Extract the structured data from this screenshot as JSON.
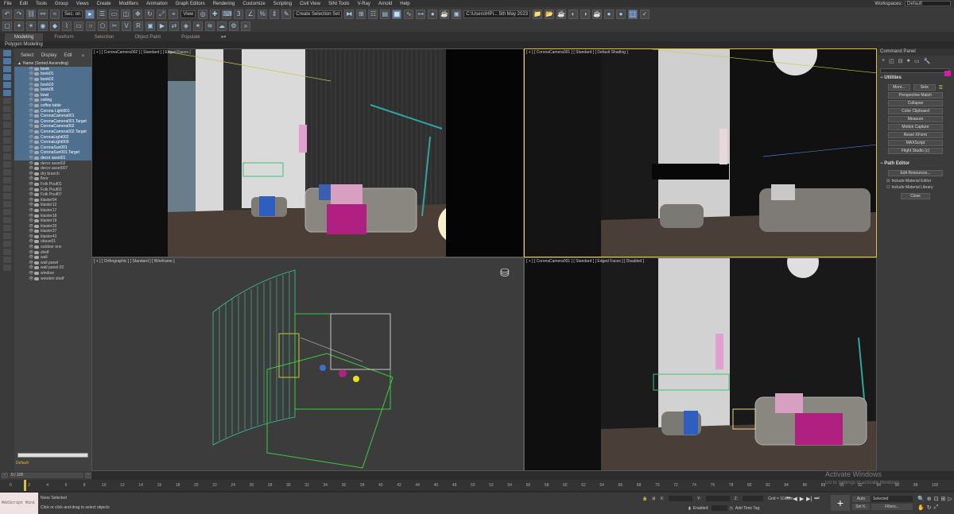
{
  "menu": [
    "File",
    "Edit",
    "Tools",
    "Group",
    "Views",
    "Create",
    "Modifiers",
    "Animation",
    "Graph Editors",
    "Rendering",
    "Customize",
    "Scripting",
    "Civil View",
    "SiNi Tools",
    "V-Ray",
    "Arnold",
    "Help"
  ],
  "workspace": {
    "label": "Workspaces:",
    "value": "Default"
  },
  "toolbar": {
    "selection_filter": "Sec. on",
    "view_dropdown": "View",
    "named_selection": "Create Selection Set",
    "path": "C:\\Users\\HPi... 5th May 2023"
  },
  "ribbon": {
    "tabs": [
      "Modeling",
      "Freeform",
      "Selection",
      "Object Paint",
      "Populate"
    ],
    "sub": "Polygon Modeling"
  },
  "explorer": {
    "tabs": [
      "Select",
      "Display",
      "Edit"
    ],
    "header": "Name (Sorted Ascending)",
    "items": [
      "book",
      "book01",
      "book02",
      "book03",
      "book05",
      "bowl",
      "ceiling",
      "coffee table",
      "Corona Light001",
      "CoronaCamera001",
      "CoronaCamera001.Target",
      "CoronaCamera002",
      "CoronaCamera002.Target",
      "CoronaLight002",
      "CoronaLight009",
      "CoronaSun001",
      "CoronaSun001.Target",
      "decor asset01",
      "decor asset02",
      "decor asset007",
      "dry branch",
      "floor",
      "Folk Pouf01",
      "Folk Pouf02",
      "Folk Pouf07",
      "klaster04",
      "klaster12",
      "klaster17",
      "klaster18",
      "klaster19",
      "klaster20",
      "klaster37",
      "klaster43",
      "obuse01",
      "outdoor env",
      "shelf",
      "wall",
      "wall panel",
      "wall panel 02",
      "window",
      "wooden shelf"
    ],
    "layer": "Default",
    "frames": "0 / 100"
  },
  "viewports": {
    "tl": "[ + ] [ CoronaCamera002 ] [ Standard ] [ Edged Faces ]",
    "tr": "[ + ] [ CoronaCamera001 ] [ Standard ] [ Default Shading ]",
    "bl": "[ + ] [ Orthographic ] [ Standard ] [ Wireframe ]",
    "br": "[ + ] [ CoronaCamera001 ] [ Standard ] [ Edged Faces ] [ Disabled ]"
  },
  "command": {
    "title": "Command Panel",
    "utilities": "Utilities",
    "more": "More...",
    "sets": "Sets",
    "buttons": [
      "Perspective Match",
      "Collapse",
      "Color Clipboard",
      "Measure",
      "Motion Capture",
      "Reset XForm",
      "MAXScript",
      "Flight Studio (c)"
    ],
    "path_editor": "Path Editor",
    "edit_resources": "Edit Resources...",
    "include_material_editor": "Include Material Editor",
    "include_material_library": "Include Material Library",
    "close": "Close"
  },
  "timeline": {
    "ticks": [
      "0",
      "2",
      "4",
      "6",
      "8",
      "10",
      "12",
      "14",
      "16",
      "18",
      "20",
      "22",
      "24",
      "26",
      "28",
      "30",
      "32",
      "34",
      "36",
      "38",
      "40",
      "42",
      "44",
      "46",
      "48",
      "50",
      "52",
      "54",
      "56",
      "58",
      "60",
      "62",
      "64",
      "66",
      "68",
      "70",
      "72",
      "74",
      "76",
      "78",
      "80",
      "82",
      "84",
      "86",
      "88",
      "90",
      "92",
      "94",
      "96",
      "98",
      "100"
    ]
  },
  "status": {
    "maxscript": "MAXScript Mini",
    "selection": "None Selected",
    "prompt": "Click or click-and-drag to select objects",
    "x": "X:",
    "y": "Y:",
    "z": "Z:",
    "grid": "Grid = 10.0cm",
    "enabled": "Enabled:",
    "add_time_tag": "Add Time Tag",
    "auto": "Auto",
    "set_key": "Set K.",
    "selected": "Selected",
    "filters": "Filters..."
  },
  "watermark": {
    "title": "Activate Windows",
    "sub": "Go to Settings to activate Windows."
  }
}
